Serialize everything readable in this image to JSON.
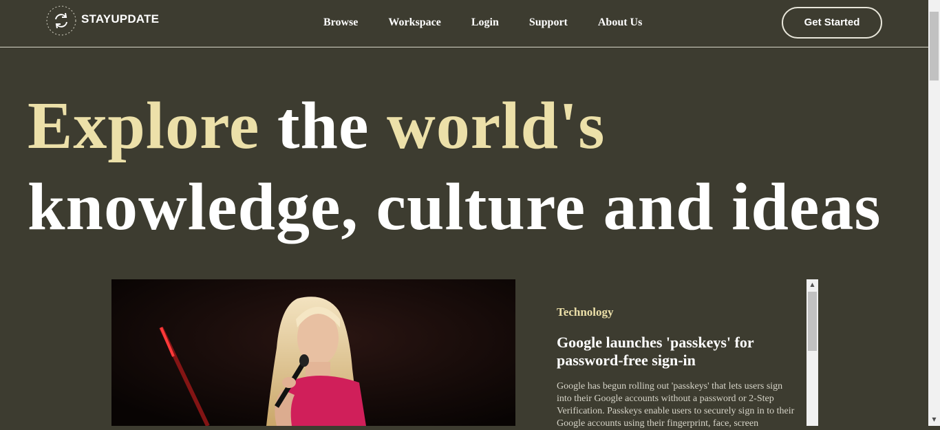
{
  "brand": {
    "name": "STAYUPDATE",
    "badge_ring_text": "STAYUPDATE"
  },
  "nav": {
    "items": [
      "Browse",
      "Workspace",
      "Login",
      "Support",
      "About Us"
    ]
  },
  "cta": {
    "label": "Get Started"
  },
  "hero": {
    "line1": {
      "word1": "Explore",
      "word2": "the",
      "word3": "world's"
    },
    "line2": "knowledge, culture and ideas"
  },
  "featured": {
    "category": "Technology",
    "headline": "Google launches 'passkeys' for password-free sign-in",
    "summary": "Google has begun rolling out 'passkeys' that lets users sign into their Google accounts without a password or 2-Step Verification. Passkeys enable users to securely sign in to their Google accounts using their fingerprint, face, screen"
  },
  "colors": {
    "background": "#3d3c30",
    "accent": "#ece0a9",
    "text": "#ffffff"
  },
  "icons": {
    "logo": "refresh-cycle-icon",
    "scroll_up": "arrow-up-icon",
    "scroll_down": "arrow-down-icon"
  }
}
